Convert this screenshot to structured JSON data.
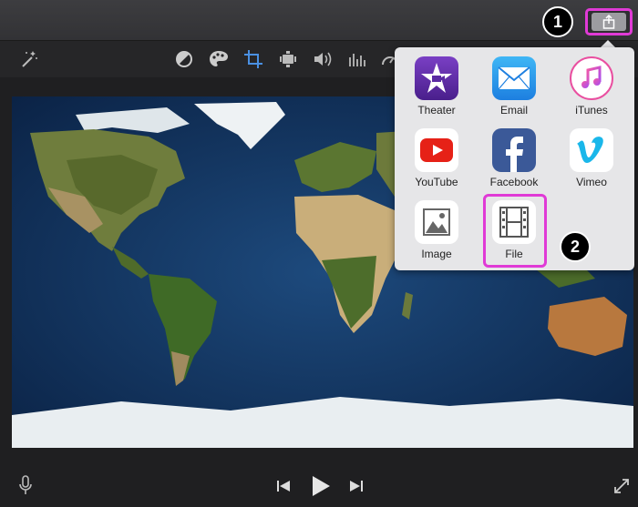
{
  "steps": {
    "step1": "1",
    "step2": "2"
  },
  "share_menu": {
    "items": [
      {
        "label": "Theater",
        "icon": "theater-star-icon"
      },
      {
        "label": "Email",
        "icon": "mail-envelope-icon"
      },
      {
        "label": "iTunes",
        "icon": "music-note-icon"
      },
      {
        "label": "YouTube",
        "icon": "youtube-play-icon"
      },
      {
        "label": "Facebook",
        "icon": "facebook-f-icon"
      },
      {
        "label": "Vimeo",
        "icon": "vimeo-v-icon"
      },
      {
        "label": "Image",
        "icon": "image-landscape-icon"
      },
      {
        "label": "File",
        "icon": "film-strip-icon"
      }
    ]
  },
  "colors": {
    "highlight": "#e03ad6",
    "popover_bg": "#e6e6e8",
    "app_bg": "#1f1f21",
    "ocean": "#0f2d55"
  },
  "toolbar_icons": [
    "magic-wand-icon",
    "color-balance-icon",
    "palette-icon",
    "crop-icon",
    "stabilization-camera-icon",
    "volume-icon",
    "equalizer-icon",
    "speed-icon"
  ],
  "playback_icons": [
    "microphone-icon",
    "skip-back-icon",
    "play-icon",
    "skip-forward-icon",
    "fullscreen-icon"
  ]
}
